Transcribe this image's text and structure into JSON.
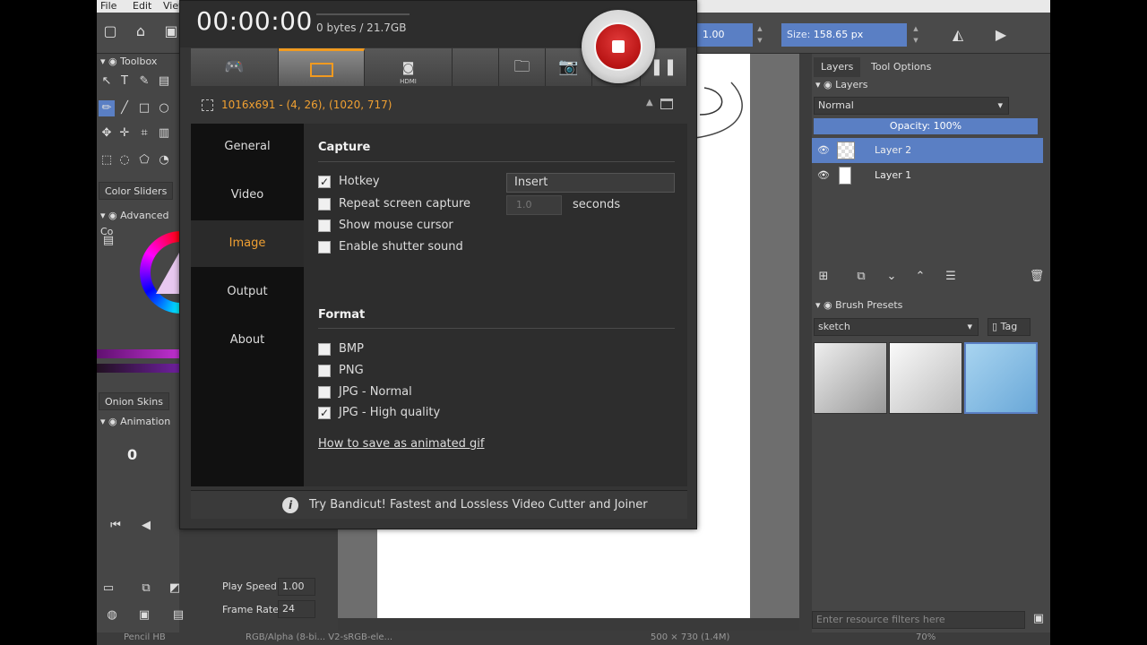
{
  "krita": {
    "menu": [
      "File",
      "Edit",
      "View"
    ],
    "opacity_value": "1.00",
    "size_label": "Size:",
    "size_value": "158.65 px",
    "left_panel": {
      "toolbox": "Toolbox",
      "color_sliders_tab": "Color Sliders",
      "advanced_color": "Advanced Co",
      "onion_skins_tab": "Onion Skins",
      "animation": "Animation",
      "frame_number": "0",
      "play_speed_label": "Play Speed:",
      "play_speed_value": "1.00",
      "frame_rate_label": "Frame Rate:",
      "frame_rate_value": "24"
    },
    "right_panel": {
      "tabs": [
        "Layers",
        "Tool Options"
      ],
      "layers_title": "Layers",
      "blend_mode": "Normal",
      "opacity": "Opacity: 100%",
      "layers": [
        "Layer 2",
        "Layer 1"
      ],
      "brush_presets": "Brush Presets",
      "brush_tag": "sketch",
      "tag_label": "Tag",
      "filter_placeholder": "Enter resource filters here"
    },
    "status": {
      "left": "Pencil HB",
      "mid": "RGB/Alpha (8-bi... V2-sRGB-ele...",
      "dims": "500 × 730 (1.4M)",
      "zoom": "70%"
    }
  },
  "bandicam": {
    "timer": "00:00:00",
    "size": "0 bytes / 21.7GB",
    "toolbar": {
      "tabs": [
        {
          "name": "game-mode",
          "icon": "gamepad-icon"
        },
        {
          "name": "screen-mode",
          "icon": "screen-rect-icon",
          "active": true
        },
        {
          "name": "hdmi-mode",
          "icon": "hdmi-icon",
          "label": "HDMI"
        }
      ],
      "folder_icon": "folder-icon",
      "camera_icon": "camera-icon",
      "pause_icon": "pause-icon"
    },
    "region": "1016x691 - (4, 26), (1020, 717)",
    "sidebar": {
      "items": [
        {
          "label": "General",
          "active": false
        },
        {
          "label": "Video",
          "active": false
        },
        {
          "label": "Image",
          "active": true
        },
        {
          "label": "Output",
          "active": false
        },
        {
          "label": "About",
          "active": false
        }
      ]
    },
    "capture": {
      "title": "Capture",
      "hotkey_label": "Hotkey",
      "hotkey_checked": true,
      "hotkey_value": "Insert",
      "repeat_label": "Repeat screen capture",
      "repeat_checked": false,
      "repeat_value": "1.0",
      "seconds_label": "seconds",
      "mouse_label": "Show mouse cursor",
      "mouse_checked": false,
      "shutter_label": "Enable shutter sound",
      "shutter_checked": false
    },
    "format": {
      "title": "Format",
      "options": [
        {
          "label": "BMP",
          "checked": false
        },
        {
          "label": "PNG",
          "checked": false
        },
        {
          "label": "JPG - Normal",
          "checked": false
        },
        {
          "label": "JPG - High quality",
          "checked": true
        }
      ],
      "gif_link": "How to save as animated gif"
    },
    "footer": "Try Bandicut! Fastest and Lossless Video Cutter and Joiner",
    "accent_color": "#f0a032",
    "record_color": "#c41a1a"
  }
}
